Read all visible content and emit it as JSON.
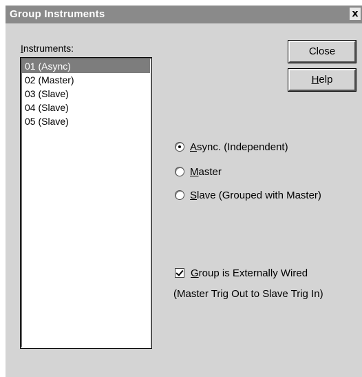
{
  "window": {
    "title": "Group Instruments",
    "close_glyph": "x"
  },
  "instruments": {
    "label_first": "I",
    "label_rest": "nstruments:",
    "items": [
      {
        "label": "01 (Async)",
        "selected": true
      },
      {
        "label": "02 (Master)",
        "selected": false
      },
      {
        "label": "03 (Slave)",
        "selected": false
      },
      {
        "label": "04 (Slave)",
        "selected": false
      },
      {
        "label": "05 (Slave)",
        "selected": false
      }
    ]
  },
  "buttons": {
    "close_label": "Close",
    "help_first": "H",
    "help_rest": "elp"
  },
  "mode_options": {
    "selected": "async",
    "async_first": "A",
    "async_rest": "sync. (Independent)",
    "master_first": "M",
    "master_rest": "aster",
    "slave_first": "S",
    "slave_rest": "lave (Grouped with Master)"
  },
  "wiring": {
    "checked": true,
    "checkbox_first": "G",
    "checkbox_rest": "roup is Externally Wired",
    "note": "(Master Trig Out to Slave Trig In)"
  }
}
